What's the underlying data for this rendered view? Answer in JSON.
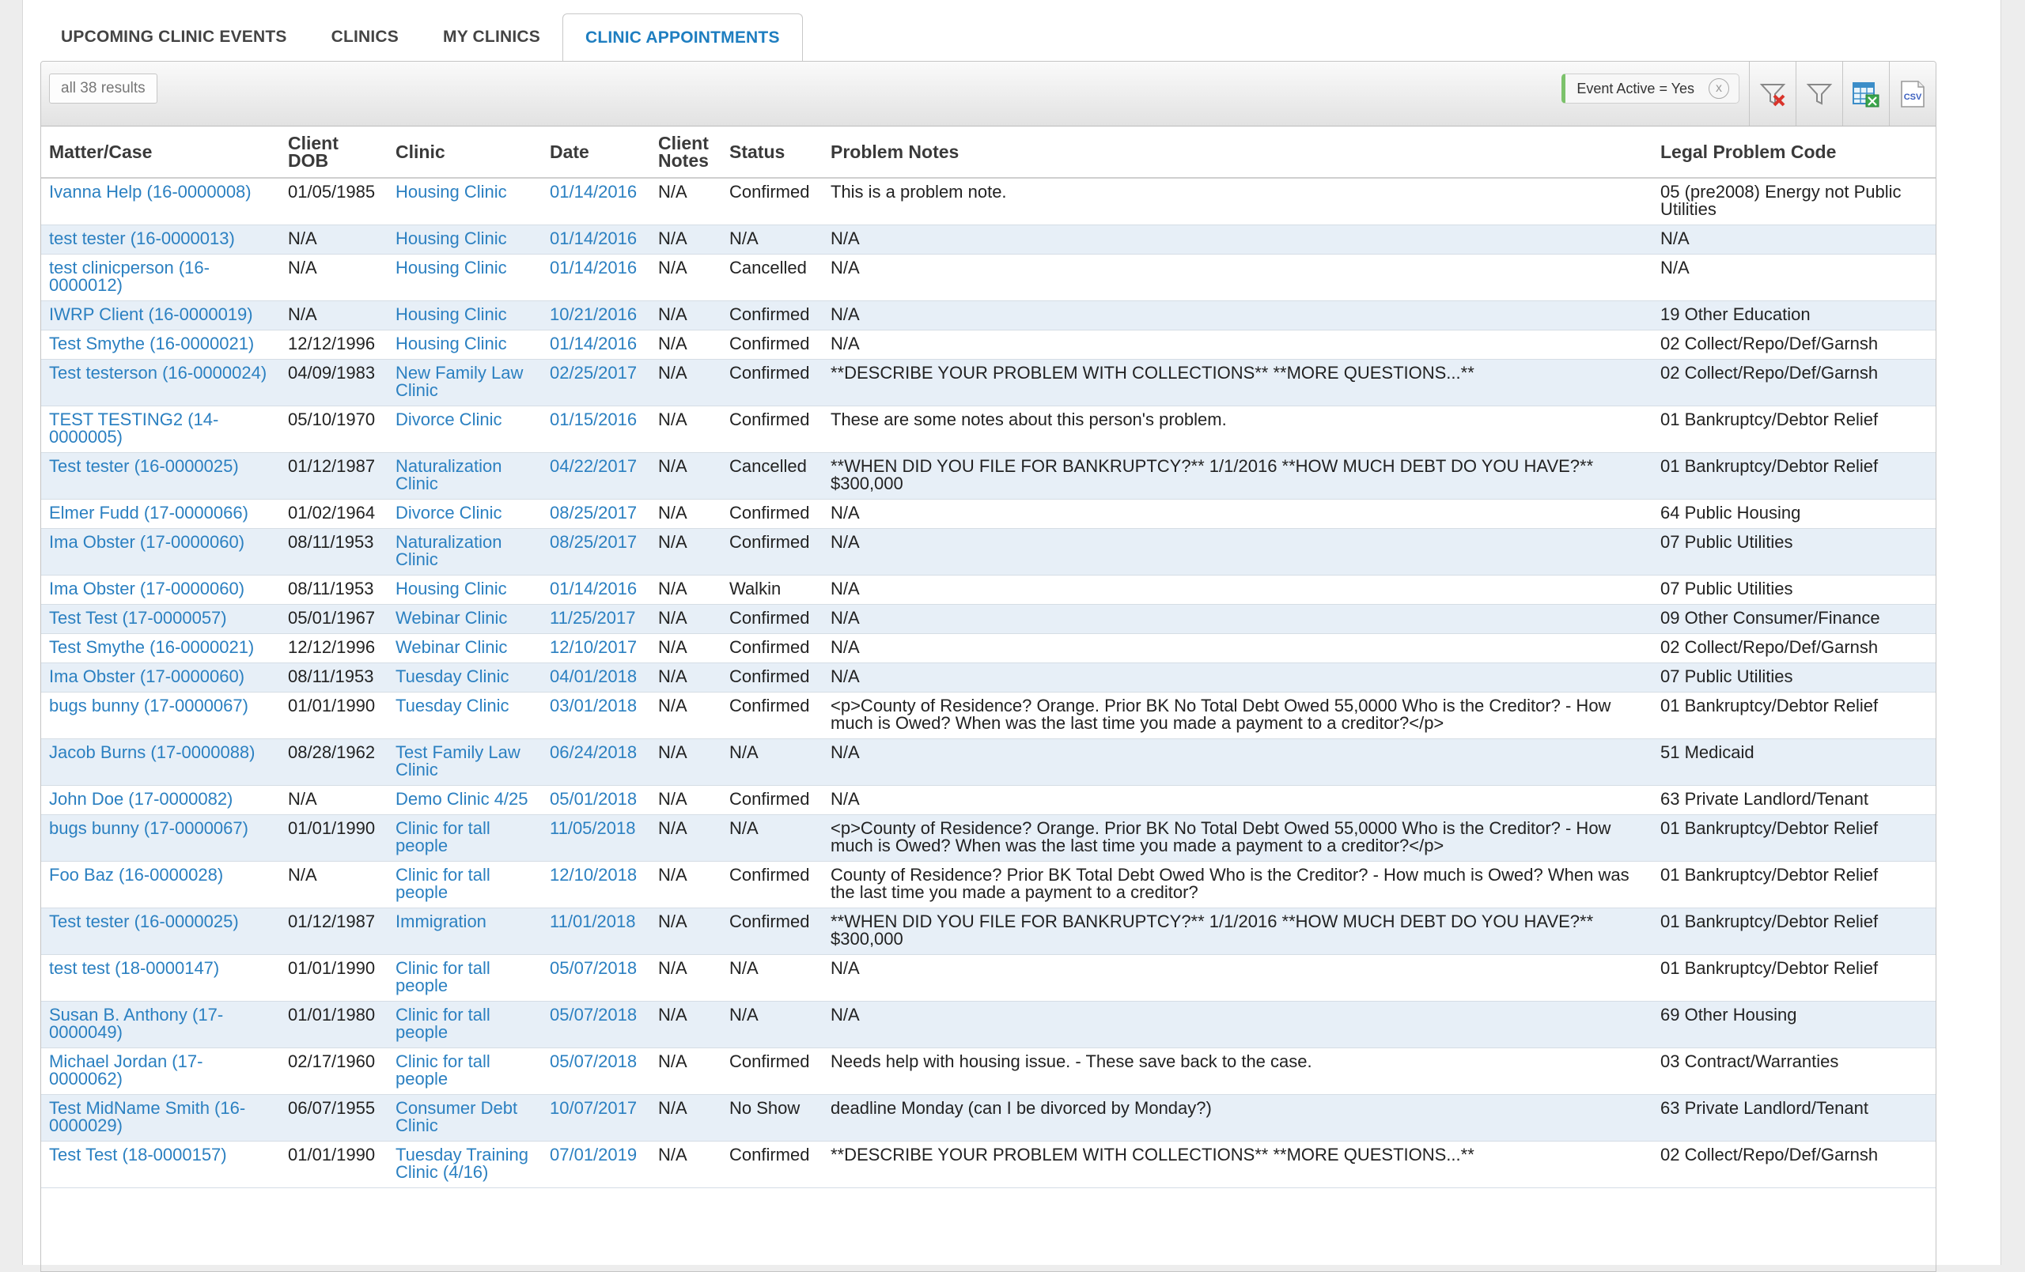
{
  "tabs": [
    "UPCOMING CLINIC EVENTS",
    "CLINICS",
    "MY CLINICS",
    "CLINIC APPOINTMENTS"
  ],
  "active_tab": 3,
  "toolbar": {
    "results_label": "all 38 results",
    "filter_chip": "Event Active = Yes",
    "chip_close": "x",
    "icons": [
      "clear-filter-icon",
      "filter-icon",
      "excel-export-icon",
      "csv-export-icon"
    ],
    "csv_text": "CSV"
  },
  "columns": [
    "Matter/Case",
    "Client DOB",
    "Clinic",
    "Date",
    "Client Notes",
    "Status",
    "Problem Notes",
    "Legal Problem Code"
  ],
  "colors": {
    "link": "#2b80c1",
    "active_tab": "#1e7ec0",
    "stripe": "#e7eff7"
  },
  "rows": [
    {
      "matter": "Ivanna Help (16-0000008)",
      "dob": "01/05/1985",
      "clinic": "Housing Clinic",
      "date": "01/14/2016",
      "notes": "N/A",
      "status": "Confirmed",
      "problem": "This is a problem note.",
      "code": "05 (pre2008) Energy not Public Utilities"
    },
    {
      "matter": "test tester (16-0000013)",
      "dob": "N/A",
      "clinic": "Housing Clinic",
      "date": "01/14/2016",
      "notes": "N/A",
      "status": "N/A",
      "problem": "N/A",
      "code": "N/A"
    },
    {
      "matter": "test clinicperson (16-0000012)",
      "dob": "N/A",
      "clinic": "Housing Clinic",
      "date": "01/14/2016",
      "notes": "N/A",
      "status": "Cancelled",
      "problem": "N/A",
      "code": "N/A"
    },
    {
      "matter": "IWRP Client (16-0000019)",
      "dob": "N/A",
      "clinic": "Housing Clinic",
      "date": "10/21/2016",
      "notes": "N/A",
      "status": "Confirmed",
      "problem": "N/A",
      "code": "19 Other Education"
    },
    {
      "matter": "Test Smythe (16-0000021)",
      "dob": "12/12/1996",
      "clinic": "Housing Clinic",
      "date": "01/14/2016",
      "notes": "N/A",
      "status": "Confirmed",
      "problem": "N/A",
      "code": "02 Collect/Repo/Def/Garnsh"
    },
    {
      "matter": "Test testerson (16-0000024)",
      "dob": "04/09/1983",
      "clinic": "New Family Law Clinic",
      "date": "02/25/2017",
      "notes": "N/A",
      "status": "Confirmed",
      "problem": "**DESCRIBE YOUR PROBLEM WITH COLLECTIONS** **MORE QUESTIONS...**",
      "code": "02 Collect/Repo/Def/Garnsh"
    },
    {
      "matter": "TEST TESTING2 (14-0000005)",
      "dob": "05/10/1970",
      "clinic": "Divorce Clinic",
      "date": "01/15/2016",
      "notes": "N/A",
      "status": "Confirmed",
      "problem": "These are some notes about this person's problem.",
      "code": "01 Bankruptcy/Debtor Relief"
    },
    {
      "matter": "Test tester (16-0000025)",
      "dob": "01/12/1987",
      "clinic": "Naturalization Clinic",
      "date": "04/22/2017",
      "notes": "N/A",
      "status": "Cancelled",
      "problem": "**WHEN DID YOU FILE FOR BANKRUPTCY?** 1/1/2016 **HOW MUCH DEBT DO YOU HAVE?** $300,000",
      "code": "01 Bankruptcy/Debtor Relief"
    },
    {
      "matter": "Elmer Fudd (17-0000066)",
      "dob": "01/02/1964",
      "clinic": "Divorce Clinic",
      "date": "08/25/2017",
      "notes": "N/A",
      "status": "Confirmed",
      "problem": "N/A",
      "code": "64 Public Housing"
    },
    {
      "matter": "Ima Obster (17-0000060)",
      "dob": "08/11/1953",
      "clinic": "Naturalization Clinic",
      "date": "08/25/2017",
      "notes": "N/A",
      "status": "Confirmed",
      "problem": "N/A",
      "code": "07 Public Utilities"
    },
    {
      "matter": "Ima Obster (17-0000060)",
      "dob": "08/11/1953",
      "clinic": "Housing Clinic",
      "date": "01/14/2016",
      "notes": "N/A",
      "status": "Walkin",
      "problem": "N/A",
      "code": "07 Public Utilities"
    },
    {
      "matter": "Test Test (17-0000057)",
      "dob": "05/01/1967",
      "clinic": "Webinar Clinic",
      "date": "11/25/2017",
      "notes": "N/A",
      "status": "Confirmed",
      "problem": "N/A",
      "code": "09 Other Consumer/Finance"
    },
    {
      "matter": "Test Smythe (16-0000021)",
      "dob": "12/12/1996",
      "clinic": "Webinar Clinic",
      "date": "12/10/2017",
      "notes": "N/A",
      "status": "Confirmed",
      "problem": "N/A",
      "code": "02 Collect/Repo/Def/Garnsh"
    },
    {
      "matter": "Ima Obster (17-0000060)",
      "dob": "08/11/1953",
      "clinic": "Tuesday Clinic",
      "date": "04/01/2018",
      "notes": "N/A",
      "status": "Confirmed",
      "problem": "N/A",
      "code": "07 Public Utilities"
    },
    {
      "matter": "bugs bunny (17-0000067)",
      "dob": "01/01/1990",
      "clinic": "Tuesday Clinic",
      "date": "03/01/2018",
      "notes": "N/A",
      "status": "Confirmed",
      "problem": "<p>County of Residence? Orange. Prior BK No Total Debt Owed 55,0000 Who is the Creditor? - How much is Owed? When was the last time you made a payment to a creditor?</p>",
      "code": "01 Bankruptcy/Debtor Relief"
    },
    {
      "matter": "Jacob Burns (17-0000088)",
      "dob": "08/28/1962",
      "clinic": "Test Family Law Clinic",
      "date": "06/24/2018",
      "notes": "N/A",
      "status": "N/A",
      "problem": "N/A",
      "code": "51 Medicaid"
    },
    {
      "matter": "John Doe (17-0000082)",
      "dob": "N/A",
      "clinic": "Demo Clinic 4/25",
      "date": "05/01/2018",
      "notes": "N/A",
      "status": "Confirmed",
      "problem": "N/A",
      "code": "63 Private Landlord/Tenant"
    },
    {
      "matter": "bugs bunny (17-0000067)",
      "dob": "01/01/1990",
      "clinic": "Clinic for tall people",
      "date": "11/05/2018",
      "notes": "N/A",
      "status": "N/A",
      "problem": "<p>County of Residence? Orange. Prior BK No Total Debt Owed 55,0000 Who is the Creditor? - How much is Owed? When was the last time you made a payment to a creditor?</p>",
      "code": "01 Bankruptcy/Debtor Relief"
    },
    {
      "matter": "Foo Baz (16-0000028)",
      "dob": "N/A",
      "clinic": "Clinic for tall people",
      "date": "12/10/2018",
      "notes": "N/A",
      "status": "Confirmed",
      "problem": "County of Residence? Prior BK Total Debt Owed Who is the Creditor? - How much is Owed? When was the last time you made a payment to a creditor?",
      "code": "01 Bankruptcy/Debtor Relief"
    },
    {
      "matter": "Test tester (16-0000025)",
      "dob": "01/12/1987",
      "clinic": "Immigration",
      "date": "11/01/2018",
      "notes": "N/A",
      "status": "Confirmed",
      "problem": "**WHEN DID YOU FILE FOR BANKRUPTCY?** 1/1/2016 **HOW MUCH DEBT DO YOU HAVE?** $300,000",
      "code": "01 Bankruptcy/Debtor Relief"
    },
    {
      "matter": "test test (18-0000147)",
      "dob": "01/01/1990",
      "clinic": "Clinic for tall people",
      "date": "05/07/2018",
      "notes": "N/A",
      "status": "N/A",
      "problem": "N/A",
      "code": "01 Bankruptcy/Debtor Relief"
    },
    {
      "matter": "Susan B. Anthony (17-0000049)",
      "dob": "01/01/1980",
      "clinic": "Clinic for tall people",
      "date": "05/07/2018",
      "notes": "N/A",
      "status": "N/A",
      "problem": "N/A",
      "code": "69 Other Housing"
    },
    {
      "matter": "Michael Jordan (17-0000062)",
      "dob": "02/17/1960",
      "clinic": "Clinic for tall people",
      "date": "05/07/2018",
      "notes": "N/A",
      "status": "Confirmed",
      "problem": "Needs help with housing issue. - These save back to the case.",
      "code": "03 Contract/Warranties"
    },
    {
      "matter": "Test MidName Smith (16-0000029)",
      "dob": "06/07/1955",
      "clinic": "Consumer Debt Clinic",
      "date": "10/07/2017",
      "notes": "N/A",
      "status": "No Show",
      "problem": "deadline Monday (can I be divorced by Monday?)",
      "code": "63 Private Landlord/Tenant"
    },
    {
      "matter": "Test Test (18-0000157)",
      "dob": "01/01/1990",
      "clinic": "Tuesday Training Clinic (4/16)",
      "date": "07/01/2019",
      "notes": "N/A",
      "status": "Confirmed",
      "problem": "**DESCRIBE YOUR PROBLEM WITH COLLECTIONS** **MORE QUESTIONS...**",
      "code": "02 Collect/Repo/Def/Garnsh"
    }
  ]
}
